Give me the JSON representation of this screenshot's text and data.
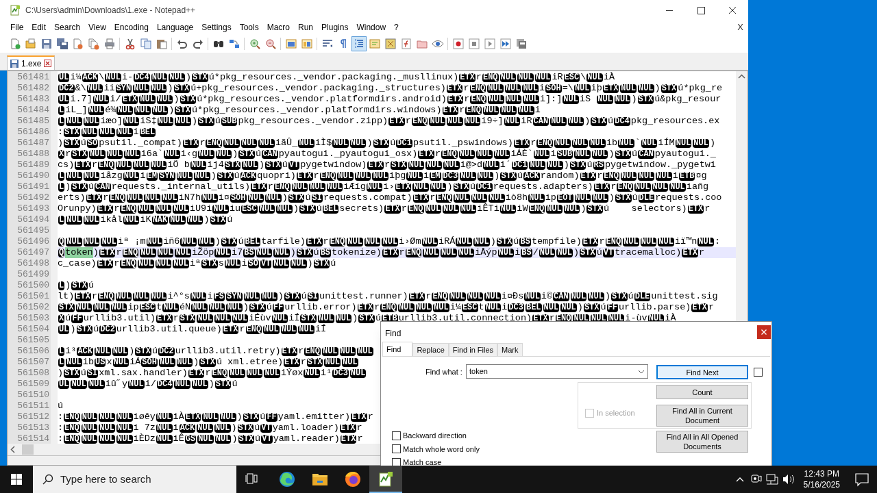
{
  "window": {
    "title": "C:\\Users\\admin\\Downloads\\1.exe - Notepad++",
    "menu": [
      "File",
      "Edit",
      "Search",
      "View",
      "Encoding",
      "Language",
      "Settings",
      "Tools",
      "Macro",
      "Run",
      "Plugins",
      "Window",
      "?"
    ],
    "menu_close": "X"
  },
  "toolbar": [
    {
      "kind": "new",
      "pressed": false
    },
    {
      "kind": "open",
      "pressed": false
    },
    {
      "kind": "save",
      "pressed": false
    },
    {
      "kind": "save_all",
      "pressed": false
    },
    {
      "kind": "close",
      "pressed": false
    },
    {
      "kind": "close_all",
      "pressed": false
    },
    {
      "kind": "print",
      "pressed": false
    },
    {
      "kind": "sep"
    },
    {
      "kind": "cut",
      "pressed": false
    },
    {
      "kind": "copy",
      "pressed": false
    },
    {
      "kind": "paste",
      "pressed": false
    },
    {
      "kind": "sep"
    },
    {
      "kind": "undo",
      "pressed": false
    },
    {
      "kind": "redo",
      "pressed": false
    },
    {
      "kind": "sep"
    },
    {
      "kind": "find",
      "pressed": false
    },
    {
      "kind": "replace",
      "pressed": false
    },
    {
      "kind": "sep"
    },
    {
      "kind": "zoom_in",
      "pressed": false
    },
    {
      "kind": "zoom_out",
      "pressed": false
    },
    {
      "kind": "sep"
    },
    {
      "kind": "sync_v",
      "pressed": false
    },
    {
      "kind": "sync_h",
      "pressed": false
    },
    {
      "kind": "sep"
    },
    {
      "kind": "wrap",
      "pressed": false
    },
    {
      "kind": "all_chars",
      "pressed": false
    },
    {
      "kind": "indent_guide",
      "pressed": true
    },
    {
      "kind": "udl",
      "pressed": false
    },
    {
      "kind": "doc_map",
      "pressed": false
    },
    {
      "kind": "func_list",
      "pressed": false
    },
    {
      "kind": "folder",
      "pressed": false
    },
    {
      "kind": "monitor",
      "pressed": false
    },
    {
      "kind": "sep"
    },
    {
      "kind": "record",
      "pressed": false
    },
    {
      "kind": "stop",
      "pressed": false
    },
    {
      "kind": "play",
      "pressed": false
    },
    {
      "kind": "play_multi",
      "pressed": false
    },
    {
      "kind": "save_macro",
      "pressed": false
    }
  ],
  "tabs": [
    {
      "label": "1.exe",
      "selected": true
    }
  ],
  "editor": {
    "lines": [
      {
        "number": "561481",
        "current": false,
        "segments": [
          {
            "ctrl": "UL"
          },
          "i¼",
          {
            "ctrl": "ACK"
          },
          "\\",
          {
            "ctrl": "NUL"
          },
          "i-",
          {
            "ctrl": "DC4"
          },
          {
            "ctrl": "NUL"
          },
          {
            "ctrl": "NUL"
          },
          ")",
          {
            "ctrl": "STX"
          },
          "ú*pkg_resources._vendor.packaging._musllinux)",
          {
            "ctrl": "ETX"
          },
          "r",
          {
            "ctrl": "ENQ"
          },
          {
            "ctrl": "NUL"
          },
          {
            "ctrl": "NUL"
          },
          {
            "ctrl": "NUL"
          },
          "iR",
          {
            "ctrl": "ESC"
          },
          "\\",
          {
            "ctrl": "NUL"
          },
          "iÀ"
        ]
      },
      {
        "number": "561482",
        "current": false,
        "segments": [
          {
            "ctrl": "DC2"
          },
          "&\\",
          {
            "ctrl": "NUL"
          },
          "ii",
          {
            "ctrl": "SYN"
          },
          {
            "ctrl": "NUL"
          },
          {
            "ctrl": "NUL"
          },
          ")",
          {
            "ctrl": "STX"
          },
          "ú+pkg_resources._vendor.packaging._structures)",
          {
            "ctrl": "ETX"
          },
          "r",
          {
            "ctrl": "ENQ"
          },
          {
            "ctrl": "NUL"
          },
          {
            "ctrl": "NUL"
          },
          {
            "ctrl": "NUL"
          },
          "i",
          {
            "ctrl": "SOH"
          },
          "=\\",
          {
            "ctrl": "NUL"
          },
          "iþ",
          {
            "ctrl": "ETX"
          },
          {
            "ctrl": "NUL"
          },
          {
            "ctrl": "NUL"
          },
          ")",
          {
            "ctrl": "STX"
          },
          "ú*pkg_re"
        ]
      },
      {
        "number": "561483",
        "current": false,
        "segments": [
          {
            "ctrl": "UL"
          },
          "i.7]",
          {
            "ctrl": "NUL"
          },
          "i/",
          {
            "ctrl": "ETX"
          },
          {
            "ctrl": "NUL"
          },
          {
            "ctrl": "NUL"
          },
          ")",
          {
            "ctrl": "STX"
          },
          "ú*pkg_resources._vendor.platformdirs.android)",
          {
            "ctrl": "ETX"
          },
          "r",
          {
            "ctrl": "ENQ"
          },
          {
            "ctrl": "NUL"
          },
          {
            "ctrl": "NUL"
          },
          {
            "ctrl": "NUL"
          },
          "i]:]",
          {
            "ctrl": "NUL"
          },
          "iS ",
          {
            "ctrl": "NUL"
          },
          {
            "ctrl": "NUL"
          },
          ")",
          {
            "ctrl": "STX"
          },
          "ú&pkg_resour"
        ]
      },
      {
        "number": "561484",
        "current": false,
        "segments": [
          {
            "ctrl": "L"
          },
          "iL_]",
          {
            "ctrl": "NUL"
          },
          "é¾",
          {
            "ctrl": "NUL"
          },
          {
            "ctrl": "NUL"
          },
          {
            "ctrl": "NUL"
          },
          ")",
          {
            "ctrl": "STX"
          },
          "ú*pkg_resources._vendor.platformdirs.windows)",
          {
            "ctrl": "ETX"
          },
          "r",
          {
            "ctrl": "ENQ"
          },
          {
            "ctrl": "NUL"
          },
          {
            "ctrl": "NUL"
          },
          {
            "ctrl": "NUL"
          },
          "i"
        ]
      },
      {
        "number": "561485",
        "current": false,
        "segments": [
          {
            "ctrl": "L"
          },
          {
            "ctrl": "NUL"
          },
          {
            "ctrl": "NUL"
          },
          "iæo]",
          {
            "ctrl": "NUL"
          },
          "iS‡",
          {
            "ctrl": "NUL"
          },
          {
            "ctrl": "NUL"
          },
          ")",
          {
            "ctrl": "STX"
          },
          "ú",
          {
            "ctrl": "SUB"
          },
          "pkg_resources._vendor.zipp)",
          {
            "ctrl": "ETX"
          },
          "r",
          {
            "ctrl": "ENQ"
          },
          {
            "ctrl": "NUL"
          },
          {
            "ctrl": "NUL"
          },
          {
            "ctrl": "NUL"
          },
          "i9÷]",
          {
            "ctrl": "NUL"
          },
          "iR",
          {
            "ctrl": "CAN"
          },
          {
            "ctrl": "NUL"
          },
          {
            "ctrl": "NUL"
          },
          ")",
          {
            "ctrl": "STX"
          },
          "ú",
          {
            "ctrl": "DC4"
          },
          "pkg_resources.ex"
        ]
      },
      {
        "number": "561486",
        "current": false,
        "segments": [
          ":",
          {
            "ctrl": "STX"
          },
          {
            "ctrl": "NUL"
          },
          {
            "ctrl": "NUL"
          },
          {
            "ctrl": "NUL"
          },
          "i",
          {
            "ctrl": "BEL"
          }
        ]
      },
      {
        "number": "561487",
        "current": false,
        "segments": [
          ")",
          {
            "ctrl": "STX"
          },
          "ú",
          {
            "ctrl": "SO"
          },
          "psutil._compat)",
          {
            "ctrl": "ETX"
          },
          "r",
          {
            "ctrl": "ENQ"
          },
          {
            "ctrl": "NUL"
          },
          {
            "ctrl": "NUL"
          },
          {
            "ctrl": "NUL"
          },
          "iãÛ_",
          {
            "ctrl": "NUL"
          },
          "iÌ$",
          {
            "ctrl": "NUL"
          },
          {
            "ctrl": "NUL"
          },
          ")",
          {
            "ctrl": "STX"
          },
          "ú",
          {
            "ctrl": "DC1"
          },
          "psutil._pswindows)",
          {
            "ctrl": "ETX"
          },
          "r",
          {
            "ctrl": "ENQ"
          },
          {
            "ctrl": "NUL"
          },
          {
            "ctrl": "NUL"
          },
          {
            "ctrl": "NUL"
          },
          "ib",
          {
            "ctrl": "NUL"
          },
          "`",
          {
            "ctrl": "NUL"
          },
          "iÍM",
          {
            "ctrl": "NUL"
          },
          {
            "ctrl": "NUL"
          },
          ")"
        ]
      },
      {
        "number": "561488",
        "current": false,
        "segments": [
          {
            "ctrl": "X"
          },
          "r",
          {
            "ctrl": "STX"
          },
          {
            "ctrl": "NUL"
          },
          {
            "ctrl": "NUL"
          },
          {
            "ctrl": "NUL"
          },
          "i6a`",
          {
            "ctrl": "NUL"
          },
          "i‹g",
          {
            "ctrl": "NUL"
          },
          {
            "ctrl": "NUL"
          },
          ")",
          {
            "ctrl": "STX"
          },
          "ú",
          {
            "ctrl": "CAN"
          },
          "pyautogui._pyautogui_osx)",
          {
            "ctrl": "ETX"
          },
          "r",
          {
            "ctrl": "ENQ"
          },
          {
            "ctrl": "NUL"
          },
          {
            "ctrl": "NUL"
          },
          {
            "ctrl": "NUL"
          },
          "iÁÈ`",
          {
            "ctrl": "NUL"
          },
          "i",
          {
            "ctrl": "SUB"
          },
          {
            "ctrl": "NUL"
          },
          {
            "ctrl": "NUL"
          },
          ")",
          {
            "ctrl": "STX"
          },
          "ú",
          {
            "ctrl": "CAN"
          },
          "pyautogui._"
        ]
      },
      {
        "number": "561489",
        "current": false,
        "segments": [
          "cs)",
          {
            "ctrl": "ETX"
          },
          "r",
          {
            "ctrl": "ENQ"
          },
          {
            "ctrl": "NUL"
          },
          {
            "ctrl": "NUL"
          },
          {
            "ctrl": "NUL"
          },
          "iÖ b",
          {
            "ctrl": "NUL"
          },
          "ij4",
          {
            "ctrl": "STX"
          },
          {
            "ctrl": "NUL"
          },
          ")",
          {
            "ctrl": "STX"
          },
          "ú",
          {
            "ctrl": "VT"
          },
          "pygetwindow)",
          {
            "ctrl": "ETX"
          },
          "r",
          {
            "ctrl": "STX"
          },
          {
            "ctrl": "NUL"
          },
          {
            "ctrl": "NUL"
          },
          {
            "ctrl": "NUL"
          },
          "i@>d",
          {
            "ctrl": "NUL"
          },
          "i´",
          {
            "ctrl": "DC1"
          },
          {
            "ctrl": "NUL"
          },
          {
            "ctrl": "NUL"
          },
          ")",
          {
            "ctrl": "STX"
          },
          "ú",
          {
            "ctrl": "RS"
          },
          "pygetwindow._pygetwi"
        ]
      },
      {
        "number": "561490",
        "current": false,
        "segments": [
          {
            "ctrl": "L"
          },
          {
            "ctrl": "NUL"
          },
          {
            "ctrl": "NUL"
          },
          "iåzg",
          {
            "ctrl": "NUL"
          },
          "i",
          {
            "ctrl": "EM"
          },
          {
            "ctrl": "SYN"
          },
          {
            "ctrl": "NUL"
          },
          {
            "ctrl": "NUL"
          },
          ")",
          {
            "ctrl": "STX"
          },
          "ú",
          {
            "ctrl": "ACK"
          },
          "quopri)",
          {
            "ctrl": "ETX"
          },
          "r",
          {
            "ctrl": "ENQ"
          },
          {
            "ctrl": "NUL"
          },
          {
            "ctrl": "NUL"
          },
          {
            "ctrl": "NUL"
          },
          "iþg",
          {
            "ctrl": "NUL"
          },
          "i",
          {
            "ctrl": "EM"
          },
          {
            "ctrl": "DC3"
          },
          {
            "ctrl": "NUL"
          },
          {
            "ctrl": "NUL"
          },
          ")",
          {
            "ctrl": "STX"
          },
          "ú",
          {
            "ctrl": "ACK"
          },
          "random)",
          {
            "ctrl": "ETX"
          },
          "r",
          {
            "ctrl": "ENQ"
          },
          {
            "ctrl": "NUL"
          },
          {
            "ctrl": "NUL"
          },
          {
            "ctrl": "NUL"
          },
          "i",
          {
            "ctrl": "ETB"
          },
          "¤g"
        ]
      },
      {
        "number": "561491",
        "current": false,
        "segments": [
          {
            "ctrl": "L"
          },
          ")",
          {
            "ctrl": "STX"
          },
          "ú",
          {
            "ctrl": "CAN"
          },
          "requests._internal_utils)",
          {
            "ctrl": "ETX"
          },
          "r",
          {
            "ctrl": "ENQ"
          },
          {
            "ctrl": "NUL"
          },
          {
            "ctrl": "NUL"
          },
          {
            "ctrl": "NUL"
          },
          "iÆíg",
          {
            "ctrl": "NUL"
          },
          "i›",
          {
            "ctrl": "ETX"
          },
          {
            "ctrl": "NUL"
          },
          {
            "ctrl": "NUL"
          },
          ")",
          {
            "ctrl": "STX"
          },
          "ú",
          {
            "ctrl": "DC1"
          },
          "requests.adapters)",
          {
            "ctrl": "ETX"
          },
          "r",
          {
            "ctrl": "ENQ"
          },
          {
            "ctrl": "NUL"
          },
          {
            "ctrl": "NUL"
          },
          {
            "ctrl": "NUL"
          },
          "iañg"
        ]
      },
      {
        "number": "561492",
        "current": false,
        "segments": [
          "erts)",
          {
            "ctrl": "ETX"
          },
          "r",
          {
            "ctrl": "ENQ"
          },
          {
            "ctrl": "NUL"
          },
          {
            "ctrl": "NUL"
          },
          {
            "ctrl": "NUL"
          },
          "iN7h",
          {
            "ctrl": "NUL"
          },
          "i¤",
          {
            "ctrl": "SOH"
          },
          {
            "ctrl": "NUL"
          },
          {
            "ctrl": "NUL"
          },
          ")",
          {
            "ctrl": "STX"
          },
          "ú",
          {
            "ctrl": "SI"
          },
          "requests.compat)",
          {
            "ctrl": "ETX"
          },
          "r",
          {
            "ctrl": "ENQ"
          },
          {
            "ctrl": "NUL"
          },
          {
            "ctrl": "NUL"
          },
          {
            "ctrl": "NUL"
          },
          "iò8h",
          {
            "ctrl": "NUL"
          },
          "ip",
          {
            "ctrl": "EOT"
          },
          {
            "ctrl": "NUL"
          },
          {
            "ctrl": "NUL"
          },
          ")",
          {
            "ctrl": "STX"
          },
          "ú",
          {
            "ctrl": "DLE"
          },
          "requests.coo"
        ]
      },
      {
        "number": "561493",
        "current": false,
        "segments": [
          "Orunpy)",
          {
            "ctrl": "ETX"
          },
          "r",
          {
            "ctrl": "ENQ"
          },
          {
            "ctrl": "NUL"
          },
          {
            "ctrl": "NUL"
          },
          {
            "ctrl": "NUL"
          },
          "iU9i",
          {
            "ctrl": "NUL"
          },
          "iu",
          {
            "ctrl": "ESC"
          },
          {
            "ctrl": "NUL"
          },
          {
            "ctrl": "NUL"
          },
          ")",
          {
            "ctrl": "STX"
          },
          "ú",
          {
            "ctrl": "BEL"
          },
          "secrets)",
          {
            "ctrl": "ETX"
          },
          "r",
          {
            "ctrl": "ENQ"
          },
          {
            "ctrl": "NUL"
          },
          {
            "ctrl": "NUL"
          },
          {
            "ctrl": "NUL"
          },
          "iÊTi",
          {
            "ctrl": "NUL"
          },
          "iW",
          {
            "ctrl": "ENQ"
          },
          {
            "ctrl": "NUL"
          },
          {
            "ctrl": "NUL"
          },
          ")",
          {
            "ctrl": "STX"
          },
          "ú    selectors)",
          {
            "ctrl": "ETX"
          },
          "r"
        ]
      },
      {
        "number": "561494",
        "current": false,
        "segments": [
          {
            "ctrl": "L"
          },
          {
            "ctrl": "NUL"
          },
          {
            "ctrl": "NUL"
          },
          "ikål",
          {
            "ctrl": "NUL"
          },
          "iK",
          {
            "ctrl": "NAK"
          },
          {
            "ctrl": "NUL"
          },
          {
            "ctrl": "NUL"
          },
          ")",
          {
            "ctrl": "STX"
          },
          "ú"
        ]
      },
      {
        "number": "561495",
        "current": false
      },
      {
        "number": "561496",
        "current": false,
        "segments": [
          {
            "ctrl": "Q"
          },
          {
            "ctrl": "NUL"
          },
          {
            "ctrl": "NUL"
          },
          {
            "ctrl": "NUL"
          },
          "iª ¡m",
          {
            "ctrl": "NUL"
          },
          "iñ6",
          {
            "ctrl": "NUL"
          },
          {
            "ctrl": "NUL"
          },
          ")",
          {
            "ctrl": "STX"
          },
          "ú",
          {
            "ctrl": "BEL"
          },
          "tarfile)",
          {
            "ctrl": "ETX"
          },
          "r",
          {
            "ctrl": "ENQ"
          },
          {
            "ctrl": "NUL"
          },
          {
            "ctrl": "NUL"
          },
          {
            "ctrl": "NUL"
          },
          "i›Øm",
          {
            "ctrl": "NUL"
          },
          "iRÁ",
          {
            "ctrl": "NUL"
          },
          {
            "ctrl": "NUL"
          },
          ")",
          {
            "ctrl": "STX"
          },
          "ú",
          {
            "ctrl": "BS"
          },
          "tempfile)",
          {
            "ctrl": "ETX"
          },
          "r",
          {
            "ctrl": "ENQ"
          },
          {
            "ctrl": "NUL"
          },
          {
            "ctrl": "NUL"
          },
          {
            "ctrl": "NUL"
          },
          "iï™n",
          {
            "ctrl": "NUL"
          },
          ":"
        ]
      },
      {
        "number": "561497",
        "current": true,
        "segments": [
          {
            "ctrl": "Q"
          },
          {
            "match": "token"
          },
          ")",
          {
            "ctrl": "ETX"
          },
          "r",
          {
            "ctrl": "ENQ"
          },
          {
            "ctrl": "NUL"
          },
          {
            "ctrl": "NUL"
          },
          {
            "ctrl": "NUL"
          },
          "iŽöp",
          {
            "ctrl": "NUL"
          },
          "i7",
          {
            "ctrl": "BS"
          },
          {
            "ctrl": "NUL"
          },
          {
            "ctrl": "NUL"
          },
          ")",
          {
            "ctrl": "STX"
          },
          "ú",
          {
            "ctrl": "BS"
          },
          "tokenize)",
          {
            "ctrl": "ETX"
          },
          "r",
          {
            "ctrl": "ENQ"
          },
          {
            "ctrl": "NUL"
          },
          {
            "ctrl": "NUL"
          },
          {
            "ctrl": "NUL"
          },
          "iÅýp",
          {
            "ctrl": "NUL"
          },
          "i",
          {
            "ctrl": "BS"
          },
          "/",
          {
            "ctrl": "NUL"
          },
          {
            "ctrl": "NUL"
          },
          ")",
          {
            "ctrl": "STX"
          },
          "ú",
          {
            "ctrl": "VT"
          },
          "tracemalloc)",
          {
            "ctrl": "ETX"
          },
          "r"
        ]
      },
      {
        "number": "561498",
        "current": false,
        "segments": [
          "c_case)",
          {
            "ctrl": "ETX"
          },
          "r",
          {
            "ctrl": "ENQ"
          },
          {
            "ctrl": "NUL"
          },
          {
            "ctrl": "NUL"
          },
          {
            "ctrl": "NUL"
          },
          "iª",
          {
            "ctrl": "STX"
          },
          "s",
          {
            "ctrl": "NUL"
          },
          "i",
          {
            "ctrl": "SO"
          },
          {
            "ctrl": "VT"
          },
          {
            "ctrl": "NUL"
          },
          {
            "ctrl": "NUL"
          },
          ")",
          {
            "ctrl": "STX"
          },
          "ú"
        ]
      },
      {
        "number": "561499",
        "current": false
      },
      {
        "number": "561500",
        "current": false,
        "segments": [
          {
            "ctrl": "L"
          },
          ")",
          {
            "ctrl": "STX"
          },
          "ú"
        ]
      },
      {
        "number": "561501",
        "current": false,
        "segments": [
          "lt)",
          {
            "ctrl": "ETX"
          },
          "r",
          {
            "ctrl": "ENQ"
          },
          {
            "ctrl": "NUL"
          },
          {
            "ctrl": "NUL"
          },
          {
            "ctrl": "NUL"
          },
          "i^°s",
          {
            "ctrl": "NUL"
          },
          "i",
          {
            "ctrl": "FS"
          },
          {
            "ctrl": "SYN"
          },
          {
            "ctrl": "NUL"
          },
          {
            "ctrl": "NUL"
          },
          ")",
          {
            "ctrl": "STX"
          },
          "ú",
          {
            "ctrl": "SI"
          },
          "unittest.runner)",
          {
            "ctrl": "ETX"
          },
          "r",
          {
            "ctrl": "ENQ"
          },
          {
            "ctrl": "NUL"
          },
          {
            "ctrl": "NUL"
          },
          {
            "ctrl": "NUL"
          },
          "i¤Ðs",
          {
            "ctrl": "NUL"
          },
          "i©",
          {
            "ctrl": "CAN"
          },
          {
            "ctrl": "NUL"
          },
          {
            "ctrl": "NUL"
          },
          ")",
          {
            "ctrl": "STX"
          },
          "ú",
          {
            "ctrl": "DLE"
          },
          "unittest.sig"
        ]
      },
      {
        "number": "561502",
        "current": false,
        "segments": [
          {
            "ctrl": "STX"
          },
          {
            "ctrl": "NUL"
          },
          {
            "ctrl": "NUL"
          },
          {
            "ctrl": "NUL"
          },
          "ip",
          {
            "ctrl": "ESC"
          },
          "t",
          {
            "ctrl": "NUL"
          },
          "éN",
          {
            "ctrl": "NUL"
          },
          {
            "ctrl": "NUL"
          },
          {
            "ctrl": "NUL"
          },
          ")",
          {
            "ctrl": "STX"
          },
          "ú",
          {
            "ctrl": "FF"
          },
          "urllib.error)",
          {
            "ctrl": "ETX"
          },
          "r",
          {
            "ctrl": "ENQ"
          },
          {
            "ctrl": "NUL"
          },
          {
            "ctrl": "NUL"
          },
          {
            "ctrl": "NUL"
          },
          "i¼",
          {
            "ctrl": "ESC"
          },
          "t",
          {
            "ctrl": "NUL"
          },
          "i",
          {
            "ctrl": "DC3"
          },
          {
            "ctrl": "BEL"
          },
          {
            "ctrl": "NUL"
          },
          {
            "ctrl": "NUL"
          },
          ")",
          {
            "ctrl": "STX"
          },
          "ú",
          {
            "ctrl": "FF"
          },
          "urllib.parse)",
          {
            "ctrl": "ETX"
          },
          "r"
        ]
      },
      {
        "number": "561503",
        "current": false,
        "segments": [
          {
            "ctrl": "X"
          },
          "ú",
          {
            "ctrl": "FF"
          },
          "urllib3.util)",
          {
            "ctrl": "ETX"
          },
          "r",
          {
            "ctrl": "STX"
          },
          {
            "ctrl": "NUL"
          },
          {
            "ctrl": "NUL"
          },
          {
            "ctrl": "NUL"
          },
          "iÉùv",
          {
            "ctrl": "NUL"
          },
          "iÍ",
          {
            "ctrl": "STX"
          },
          {
            "ctrl": "NUL"
          },
          {
            "ctrl": "NUL"
          },
          ")",
          {
            "ctrl": "STX"
          },
          "ú",
          {
            "ctrl": "ETB"
          },
          "urllib3.util.connection)",
          {
            "ctrl": "ETX"
          },
          "r",
          {
            "ctrl": "ENQ"
          },
          {
            "ctrl": "NUL"
          },
          {
            "ctrl": "NUL"
          },
          {
            "ctrl": "NUL"
          },
          "i-ùv",
          {
            "ctrl": "NUL"
          },
          "iÀ"
        ]
      },
      {
        "number": "561504",
        "current": false,
        "segments": [
          {
            "ctrl": "UL"
          },
          ")",
          {
            "ctrl": "STX"
          },
          "ú",
          {
            "ctrl": "DC2"
          },
          "urllib3.util.queue)",
          {
            "ctrl": "ETX"
          },
          "r",
          {
            "ctrl": "ENQ"
          },
          {
            "ctrl": "NUL"
          },
          {
            "ctrl": "NUL"
          },
          {
            "ctrl": "NUL"
          },
          "iÍ"
        ]
      },
      {
        "number": "561505",
        "current": false
      },
      {
        "number": "561506",
        "current": false,
        "segments": [
          {
            "ctrl": "L"
          },
          "i³",
          {
            "ctrl": "ACK"
          },
          {
            "ctrl": "NUL"
          },
          {
            "ctrl": "NUL"
          },
          ")",
          {
            "ctrl": "STX"
          },
          "ú",
          {
            "ctrl": "DC2"
          },
          "urllib3.util.retry)",
          {
            "ctrl": "ETX"
          },
          "r",
          {
            "ctrl": "ENQ"
          },
          {
            "ctrl": "NUL"
          },
          {
            "ctrl": "NUL"
          },
          {
            "ctrl": "NUL"
          }
        ]
      },
      {
        "number": "561507",
        "current": false,
        "segments": [
          {
            "ctrl": "L"
          },
          {
            "ctrl": "NUL"
          },
          "ib",
          {
            "ctrl": "US"
          },
          "x",
          {
            "ctrl": "NUL"
          },
          "iÁ",
          {
            "ctrl": "SOH"
          },
          {
            "ctrl": "NUL"
          },
          {
            "ctrl": "NUL"
          },
          ")",
          {
            "ctrl": "STX"
          },
          "ú xml.etree)",
          {
            "ctrl": "ETX"
          },
          "r",
          {
            "ctrl": "STX"
          },
          {
            "ctrl": "NUL"
          },
          {
            "ctrl": "NUL"
          }
        ]
      },
      {
        "number": "561508",
        "current": false,
        "segments": [
          ")",
          {
            "ctrl": "STX"
          },
          "ú",
          {
            "ctrl": "SI"
          },
          "xml.sax.handler)",
          {
            "ctrl": "ETX"
          },
          "r",
          {
            "ctrl": "ENQ"
          },
          {
            "ctrl": "NUL"
          },
          {
            "ctrl": "NUL"
          },
          {
            "ctrl": "NUL"
          },
          "iÝøx",
          {
            "ctrl": "NUL"
          },
          "i¹",
          {
            "ctrl": "DC3"
          },
          {
            "ctrl": "NUL"
          }
        ]
      },
      {
        "number": "561509",
        "current": false,
        "segments": [
          {
            "ctrl": "UL"
          },
          {
            "ctrl": "NUL"
          },
          {
            "ctrl": "NUL"
          },
          "iû˝y",
          {
            "ctrl": "NUL"
          },
          "i/",
          {
            "ctrl": "DC4"
          },
          {
            "ctrl": "NUL"
          },
          {
            "ctrl": "NUL"
          },
          ")",
          {
            "ctrl": "STX"
          },
          "ú"
        ]
      },
      {
        "number": "561510",
        "current": false
      },
      {
        "number": "561511",
        "current": false,
        "segments": [
          "ú"
        ]
      },
      {
        "number": "561512",
        "current": false,
        "segments": [
          ":",
          {
            "ctrl": "ENQ"
          },
          {
            "ctrl": "NUL"
          },
          {
            "ctrl": "NUL"
          },
          {
            "ctrl": "NUL"
          },
          "iøêy",
          {
            "ctrl": "NUL"
          },
          "iÀ",
          {
            "ctrl": "ETX"
          },
          {
            "ctrl": "NUL"
          },
          {
            "ctrl": "NUL"
          },
          ")",
          {
            "ctrl": "STX"
          },
          "ú",
          {
            "ctrl": "FF"
          },
          "yaml.emitter)",
          {
            "ctrl": "ETX"
          },
          "r"
        ]
      },
      {
        "number": "561513",
        "current": false,
        "segments": [
          ":",
          {
            "ctrl": "ENQ"
          },
          {
            "ctrl": "NUL"
          },
          {
            "ctrl": "NUL"
          },
          {
            "ctrl": "NUL"
          },
          "i 7z",
          {
            "ctrl": "NUL"
          },
          "i",
          {
            "ctrl": "ACK"
          },
          {
            "ctrl": "NUL"
          },
          {
            "ctrl": "NUL"
          },
          ")",
          {
            "ctrl": "STX"
          },
          "ú",
          {
            "ctrl": "VT"
          },
          "yaml.loader)",
          {
            "ctrl": "ETX"
          },
          "r"
        ]
      },
      {
        "number": "561514",
        "current": false,
        "segments": [
          ":",
          {
            "ctrl": "ENQ"
          },
          {
            "ctrl": "NUL"
          },
          {
            "ctrl": "NUL"
          },
          {
            "ctrl": "NUL"
          },
          "iÈDz",
          {
            "ctrl": "NUL"
          },
          "iÊ",
          {
            "ctrl": "GS"
          },
          {
            "ctrl": "NUL"
          },
          {
            "ctrl": "NUL"
          },
          ")",
          {
            "ctrl": "STX"
          },
          "ú",
          {
            "ctrl": "VT"
          },
          "yaml.reader)",
          {
            "ctrl": "ETX"
          },
          "r"
        ]
      }
    ]
  },
  "find_dialog": {
    "title": "Find",
    "tabs": [
      {
        "label": "Find",
        "selected": true
      },
      {
        "label": "Replace",
        "selected": false
      },
      {
        "label": "Find in Files",
        "selected": false
      },
      {
        "label": "Mark",
        "selected": false
      }
    ],
    "find_what": {
      "label": "Find what :",
      "value": "token"
    },
    "side_checkbox": {
      "checked": false
    },
    "in_selection": {
      "label": "In selection",
      "checked": false,
      "disabled": true
    },
    "buttons": [
      {
        "label": "Find Next",
        "focused": true
      },
      {
        "label": "Count",
        "focused": false
      },
      {
        "label": "Find All in Current Document",
        "focused": false
      },
      {
        "label": "Find All in All Opened Documents",
        "focused": false
      }
    ],
    "options": [
      {
        "label": "Backward direction",
        "checked": false
      },
      {
        "label": "Match whole word only",
        "checked": false
      },
      {
        "label": "Match case",
        "checked": false
      }
    ]
  },
  "taskbar": {
    "search_placeholder": "Type here to search",
    "apps": [
      {
        "kind": "task_view",
        "active": false
      },
      {
        "kind": "edge",
        "active": false
      },
      {
        "kind": "explorer",
        "active": false
      },
      {
        "kind": "firefox",
        "active": false
      },
      {
        "kind": "notepadpp",
        "active": true
      }
    ],
    "time": "12:43 PM",
    "date": "5/16/2025"
  }
}
